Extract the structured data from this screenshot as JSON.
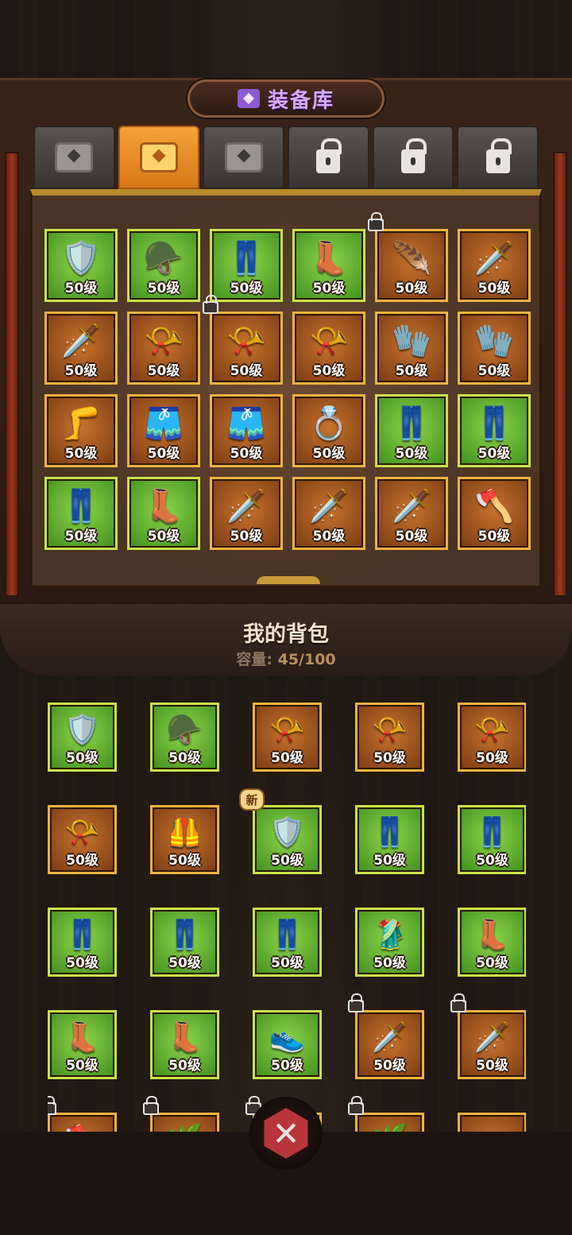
{
  "title": "装备库",
  "tabs": [
    {
      "type": "chest",
      "active": false
    },
    {
      "type": "chest",
      "active": true
    },
    {
      "type": "chest",
      "active": false
    },
    {
      "type": "locked",
      "active": false
    },
    {
      "type": "locked",
      "active": false
    },
    {
      "type": "locked",
      "active": false
    }
  ],
  "vault_items": [
    {
      "icon": "🛡️",
      "name": "blue-armor-icon",
      "rarity": "green",
      "level": "50级"
    },
    {
      "icon": "🪖",
      "name": "spiked-helmet-icon",
      "rarity": "green",
      "level": "50级"
    },
    {
      "icon": "👖",
      "name": "blue-pants-icon",
      "rarity": "green",
      "level": "50级"
    },
    {
      "icon": "👢",
      "name": "purple-boots-icon",
      "rarity": "green",
      "level": "50级"
    },
    {
      "icon": "🪶",
      "name": "feather-blade-icon",
      "rarity": "orange",
      "level": "50级",
      "locked": true
    },
    {
      "icon": "🗡️",
      "name": "purple-sword-icon",
      "rarity": "orange",
      "level": "50级"
    },
    {
      "icon": "🗡️",
      "name": "spiked-sword-icon",
      "rarity": "orange",
      "level": "50级"
    },
    {
      "icon": "📯",
      "name": "purple-horn-icon",
      "rarity": "orange",
      "level": "50级"
    },
    {
      "icon": "📯",
      "name": "horn-icon",
      "rarity": "orange",
      "level": "50级",
      "locked": true
    },
    {
      "icon": "📯",
      "name": "horn-icon",
      "rarity": "orange",
      "level": "50级"
    },
    {
      "icon": "🧤",
      "name": "fur-gauntlet-icon",
      "rarity": "orange",
      "level": "50级"
    },
    {
      "icon": "🧤",
      "name": "purple-gauntlet-icon",
      "rarity": "orange",
      "level": "50级"
    },
    {
      "icon": "🦵",
      "name": "steel-greaves-icon",
      "rarity": "orange",
      "level": "50级"
    },
    {
      "icon": "🩳",
      "name": "red-pants-icon",
      "rarity": "orange",
      "level": "50级"
    },
    {
      "icon": "🩳",
      "name": "red-pants-icon",
      "rarity": "orange",
      "level": "50级"
    },
    {
      "icon": "💍",
      "name": "ring-icon",
      "rarity": "orange",
      "level": "50级"
    },
    {
      "icon": "👖",
      "name": "dark-pants-icon",
      "rarity": "green",
      "level": "50级"
    },
    {
      "icon": "👖",
      "name": "green-pants-icon",
      "rarity": "green",
      "level": "50级"
    },
    {
      "icon": "👖",
      "name": "purple-pants-icon",
      "rarity": "green",
      "level": "50级"
    },
    {
      "icon": "👢",
      "name": "blue-fur-boots-icon",
      "rarity": "green",
      "level": "50级"
    },
    {
      "icon": "🗡️",
      "name": "dagger-icon",
      "rarity": "orange",
      "level": "50级"
    },
    {
      "icon": "🗡️",
      "name": "green-sword-icon",
      "rarity": "orange",
      "level": "50级"
    },
    {
      "icon": "🗡️",
      "name": "great-sword-icon",
      "rarity": "orange",
      "level": "50级"
    },
    {
      "icon": "🪓",
      "name": "axe-icon",
      "rarity": "orange",
      "level": "50级"
    }
  ],
  "bag": {
    "title": "我的背包",
    "capacity_label": "容量:",
    "capacity_value": "45/100"
  },
  "bag_items": [
    {
      "icon": "🛡️",
      "name": "blue-armor-icon",
      "rarity": "green",
      "level": "50级"
    },
    {
      "icon": "🪖",
      "name": "antler-helmet-icon",
      "rarity": "green",
      "level": "50级"
    },
    {
      "icon": "📯",
      "name": "horn-icon",
      "rarity": "orange",
      "level": "50级"
    },
    {
      "icon": "📯",
      "name": "horn-icon",
      "rarity": "orange",
      "level": "50级"
    },
    {
      "icon": "📯",
      "name": "purple-horn-icon",
      "rarity": "orange",
      "level": "50级"
    },
    {
      "icon": "📯",
      "name": "green-horn-icon",
      "rarity": "orange",
      "level": "50级"
    },
    {
      "icon": "🦺",
      "name": "green-armor-icon",
      "rarity": "orange",
      "level": "50级"
    },
    {
      "icon": "🛡️",
      "name": "silver-armor-icon",
      "rarity": "green",
      "level": "50级",
      "badge": "新"
    },
    {
      "icon": "👖",
      "name": "dark-pants-icon",
      "rarity": "green",
      "level": "50级"
    },
    {
      "icon": "👖",
      "name": "green-pants-icon",
      "rarity": "green",
      "level": "50级"
    },
    {
      "icon": "👖",
      "name": "blue-pants-icon",
      "rarity": "green",
      "level": "50级"
    },
    {
      "icon": "👖",
      "name": "blue-pants-icon",
      "rarity": "green",
      "level": "50级"
    },
    {
      "icon": "👖",
      "name": "purple-pants-icon",
      "rarity": "green",
      "level": "50级"
    },
    {
      "icon": "🥻",
      "name": "robe-skirt-icon",
      "rarity": "green",
      "level": "50级"
    },
    {
      "icon": "👢",
      "name": "brown-boots-icon",
      "rarity": "green",
      "level": "50级"
    },
    {
      "icon": "👢",
      "name": "blue-fur-boots-icon",
      "rarity": "green",
      "level": "50级"
    },
    {
      "icon": "👢",
      "name": "purple-boots-icon",
      "rarity": "green",
      "level": "50级"
    },
    {
      "icon": "👟",
      "name": "white-boots-icon",
      "rarity": "green",
      "level": "50级"
    },
    {
      "icon": "🗡️",
      "name": "dagger-icon",
      "rarity": "orange",
      "level": "50级",
      "locked": true
    },
    {
      "icon": "🗡️",
      "name": "dagger-icon",
      "rarity": "orange",
      "level": "50级",
      "locked": true
    },
    {
      "icon": "🪓",
      "name": "axe-icon",
      "rarity": "orange",
      "level": "",
      "locked": true
    },
    {
      "icon": "🌿",
      "name": "branch-icon",
      "rarity": "orange",
      "level": "",
      "locked": true
    },
    {
      "icon": "",
      "name": "item-icon",
      "rarity": "orange",
      "level": "",
      "locked": true
    },
    {
      "icon": "🌿",
      "name": "branch-icon",
      "rarity": "orange",
      "level": "",
      "locked": true
    },
    {
      "icon": "",
      "name": "item-icon",
      "rarity": "orange",
      "level": ""
    }
  ],
  "close_label": "✕",
  "colors": {
    "title_purple": "#d7a8ff",
    "tab_active": "#f4a238",
    "rarity_green": "#5fb22e",
    "rarity_orange": "#a9561e",
    "close_red": "#b8353a"
  }
}
